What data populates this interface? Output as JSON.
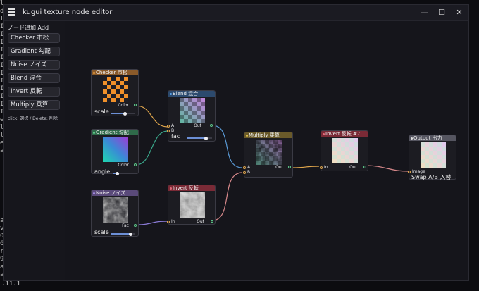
{
  "terminal": {
    "left_chars": [
      "l",
      "d",
      "l",
      "I",
      "I",
      "I",
      "I",
      "I",
      "I",
      "I",
      "I",
      "I",
      "I",
      "I",
      "I",
      "e",
      "l",
      "l",
      "e",
      "a",
      "",
      "",
      "",
      "",
      "",
      "",
      "",
      "",
      "a",
      "v",
      "0",
      "6",
      "r",
      "9",
      "a",
      "a"
    ],
    "bottom_text": ".11.1"
  },
  "window": {
    "title": "kugui texture node editor",
    "controls": {
      "minimize": "—",
      "maximize": "☐",
      "close": "✕"
    }
  },
  "sidebar": {
    "heading": "ノード追加 Add",
    "buttons": [
      "Checker 市松",
      "Gradient 勾配",
      "Noise ノイズ",
      "Blend 混合",
      "Invert 反転",
      "Multiply 乗算"
    ],
    "hint": "click: 選択 / Delete: 削除"
  },
  "nodes": {
    "checker": {
      "title": "Checker 市松",
      "out_label": "Color",
      "slider_label": "scale",
      "slider_value": 0.55,
      "color": "#8a5a2a"
    },
    "gradient": {
      "title": "Gradient 勾配",
      "out_label": "Color",
      "slider_label": "angle",
      "slider_value": 0.2,
      "color": "#2f6a4a"
    },
    "noise": {
      "title": "Noise ノイズ",
      "out_label": "Fac",
      "slider_label": "scale",
      "slider_value": 0.8,
      "color": "#5a4a7a"
    },
    "blend": {
      "title": "Blend 混合",
      "in_a": "A",
      "in_b": "B",
      "out_label": "Out",
      "slider_label": "fac",
      "slider_value": 0.75,
      "color": "#2c4a6e"
    },
    "invert1": {
      "title": "Invert 反転",
      "in_label": "In",
      "out_label": "Out",
      "color": "#7a2a36"
    },
    "multiply": {
      "title": "Multiply 乗算",
      "in_a": "A",
      "in_b": "B",
      "out_label": "Out",
      "color": "#6a5a2a"
    },
    "invert2": {
      "title": "Invert 反転 #7",
      "in_label": "In",
      "out_label": "Out",
      "color": "#7a2a36"
    },
    "output": {
      "title": "Output 出力",
      "in_label": "Image",
      "button": "Swap A/B 入替",
      "color": "#555560"
    }
  }
}
